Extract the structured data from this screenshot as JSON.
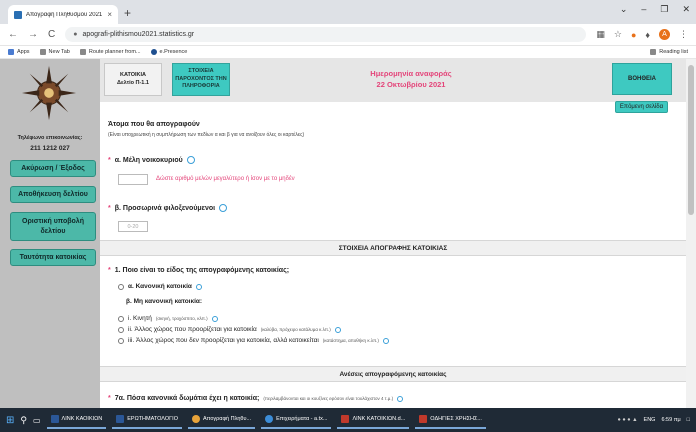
{
  "browser": {
    "tab_title": "Απογραφή Πληθυσμού 2021",
    "tab_close": "×",
    "new_tab": "+",
    "url": "apografi-plithismou2021.statistics.gr",
    "window_controls": [
      "⌄",
      "–",
      "❐",
      "✕"
    ],
    "nav": {
      "back": "←",
      "forward": "→",
      "reload": "C"
    },
    "bookmarks": [
      "Apps",
      "New Tab",
      "Route planner from...",
      "e.Presence"
    ],
    "reading_list": "Reading list",
    "profile_initial": "A"
  },
  "sidebar": {
    "contact_label": "Τηλέφωνο επικοινωνίας:",
    "contact_phone": "211 1212 027",
    "buttons": [
      "Ακύρωση / Έξοδος",
      "Αποθήκευση δελτίου",
      "Οριστική υποβολή δελτίου",
      "Ταυτότητα κατοικίας"
    ]
  },
  "header": {
    "box1_line1": "ΚΑΤΟΙΚΙΑ",
    "box1_line2": "Δελτίο Π-1.1",
    "box2_line1": "ΣΤΟΙΧΕΙΑ",
    "box2_line2": "ΠΑΡΟΧΟΝΤΟΣ ΤΗΝ",
    "box2_line3": "ΠΛΗΡΟΦΟΡΙΑ",
    "ref_label": "Ημερομηνία αναφοράς",
    "ref_date": "22 Οκτωβρίου 2021",
    "help": "ΒΟΗΘΕΙΑ",
    "next_page": "Επόμενη σελίδα"
  },
  "form": {
    "section_title": "Άτομα που θα απογραφούν",
    "section_note": "(Είναι υποχρεωτική η συμπλήρωση των πεδίων α και β για να ανοίξουν όλες οι καρτέλες)",
    "q_a_label": "α. Μέλη νοικοκυριού",
    "q_a_hint": "Δώστε αριθμό μελών μεγαλύτερο ή ίσον με το μηδέν",
    "q_b_label": "β. Προσωρινά φιλοξενούμενοι",
    "q_b_placeholder": "0-20",
    "band1": "ΣΤΟΙΧΕΙΑ ΑΠΟΓΡΑΦΗΣ ΚΑΤΟΙΚΙΑΣ",
    "q1_label": "1. Ποιο είναι το είδος της απογραφόμενης κατοικίας;",
    "opt_a": "α. Κανονική κατοικία",
    "opt_b_title": "β. Μη κανονική κατοικία:",
    "opt_i": "i. Κινητή",
    "opt_i_small": "(σκηνή, τροχόσπιτο, κλπ.)",
    "opt_ii": "ii. Άλλος χώρος που προορίζεται για κατοικία",
    "opt_ii_small": "(καλύβα, πρόχειρο κατάλυμα κ.λπ.)",
    "opt_iii": "iii. Άλλος χώρος που δεν προορίζεται για κατοικία, αλλά κατοικείται",
    "opt_iii_small": "(κατάστημα, αποθήκη κ.λπ.)",
    "band2": "Ανέσεις απογραφόμενης κατοικίας",
    "q7a_label": "7α. Πόσα κανονικά δωμάτια έχει η κατοικία;",
    "q7a_small": "(περιλαμβάνονται και οι κουζίνες εφόσον είναι τουλάχιστον 4 τ.μ.)",
    "required_mark": "*"
  },
  "taskbar": {
    "items": [
      "ΛΙΝΚ ΚΑΟΙΚΙΩΝ",
      "ΕΡΩΤΗΜΑΤΟΛΟΓΙΟ",
      "Απογραφή Πληθυ...",
      "Επιχειρήματα - a.tx...",
      "ΛΙΝΚ ΚΑΤΟΙΚΙΩΝ.d...",
      "ΟΔΗΓΙΕΣ ΧΡΗΣΗΣ..."
    ],
    "lang": "ENG",
    "time": "6:59 πμ"
  },
  "colors": {
    "teal": "#3ec9c1",
    "pink": "#e4457a",
    "sidebar_bg": "#bfbfbf",
    "taskbar": "#1f2a36"
  }
}
